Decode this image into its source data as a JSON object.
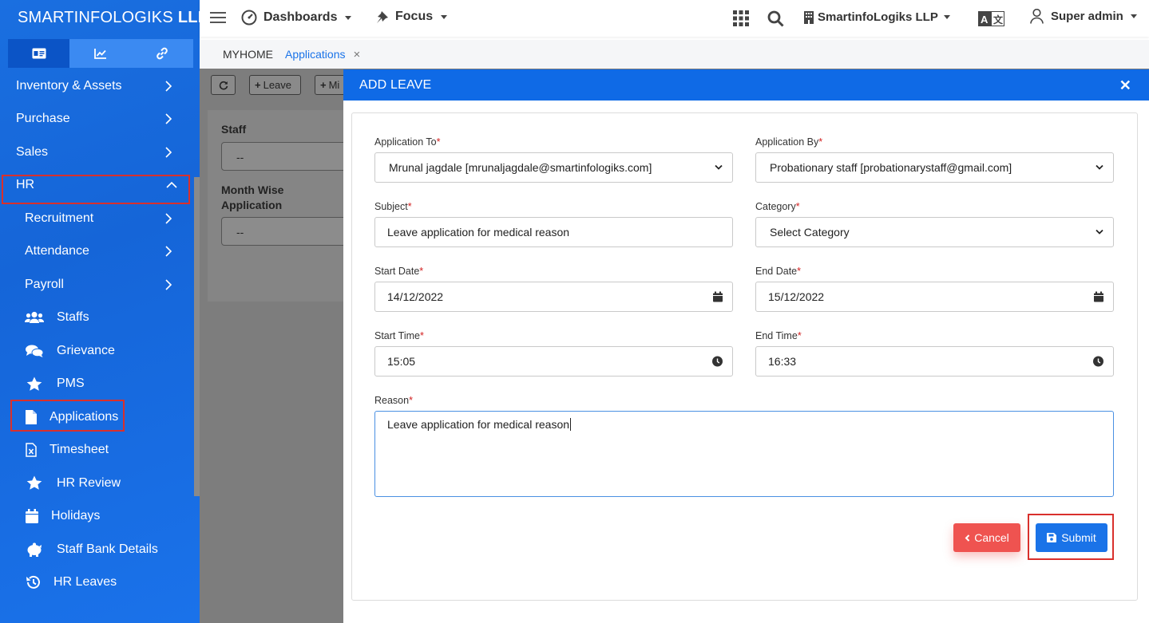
{
  "sidebar": {
    "brand_light": "SMARTINFOLOGIKS",
    "brand_bold": "LLP",
    "tabs": [
      {
        "icon": "id-card-icon"
      },
      {
        "icon": "chart-line-icon"
      },
      {
        "icon": "link-icon"
      }
    ],
    "items": [
      {
        "label": "Inventory & Assets"
      },
      {
        "label": "Purchase"
      },
      {
        "label": "Sales"
      },
      {
        "label": "HR"
      },
      {
        "label": "Recruitment"
      },
      {
        "label": "Attendance"
      },
      {
        "label": "Payroll"
      },
      {
        "label": "Staffs",
        "icon": "users-icon"
      },
      {
        "label": "Grievance",
        "icon": "comments-icon"
      },
      {
        "label": "PMS",
        "icon": "star-icon"
      },
      {
        "label": "Applications",
        "icon": "file-icon"
      },
      {
        "label": "Timesheet",
        "icon": "file-excel-icon"
      },
      {
        "label": "HR Review",
        "icon": "star-icon"
      },
      {
        "label": "Holidays",
        "icon": "calendar-icon"
      },
      {
        "label": "Staff Bank Details",
        "icon": "piggy-bank-icon"
      },
      {
        "label": "HR Leaves",
        "icon": "history-icon"
      }
    ]
  },
  "topbar": {
    "dashboards": "Dashboards",
    "focus": "Focus",
    "company": "SmartinfoLogiks LLP",
    "user": "Super admin"
  },
  "breadcrumb": {
    "home": "MYHOME",
    "current": "Applications"
  },
  "toolbar": {
    "leave": "Leave",
    "more": "Mi"
  },
  "filters": {
    "staff_label": "Staff",
    "staff_value": "--",
    "month_label_1": "Month Wise",
    "month_label_2": "Application",
    "month_value": "--"
  },
  "modal": {
    "title": "ADD LEAVE",
    "fields": {
      "application_to_label": "Application To",
      "application_to_value": "Mrunal jagdale [mrunaljagdale@smartinfologiks.com]",
      "application_by_label": "Application By",
      "application_by_value": "Probationary staff [probationarystaff@gmail.com]",
      "subject_label": "Subject",
      "subject_value": "Leave application for medical reason",
      "category_label": "Category",
      "category_value": "Select Category",
      "start_date_label": "Start Date",
      "start_date_value": "14/12/2022",
      "end_date_label": "End Date",
      "end_date_value": "15/12/2022",
      "start_time_label": "Start Time",
      "start_time_value": "15:05",
      "end_time_label": "End Time",
      "end_time_value": "16:33",
      "reason_label": "Reason",
      "reason_value": "Leave application for medical reason"
    },
    "cancel_label": "Cancel",
    "submit_label": "Submit"
  },
  "colors": {
    "primary": "#1a73e8",
    "header": "#0f6ae6",
    "danger": "#ef5350",
    "highlight": "#d9302c"
  }
}
